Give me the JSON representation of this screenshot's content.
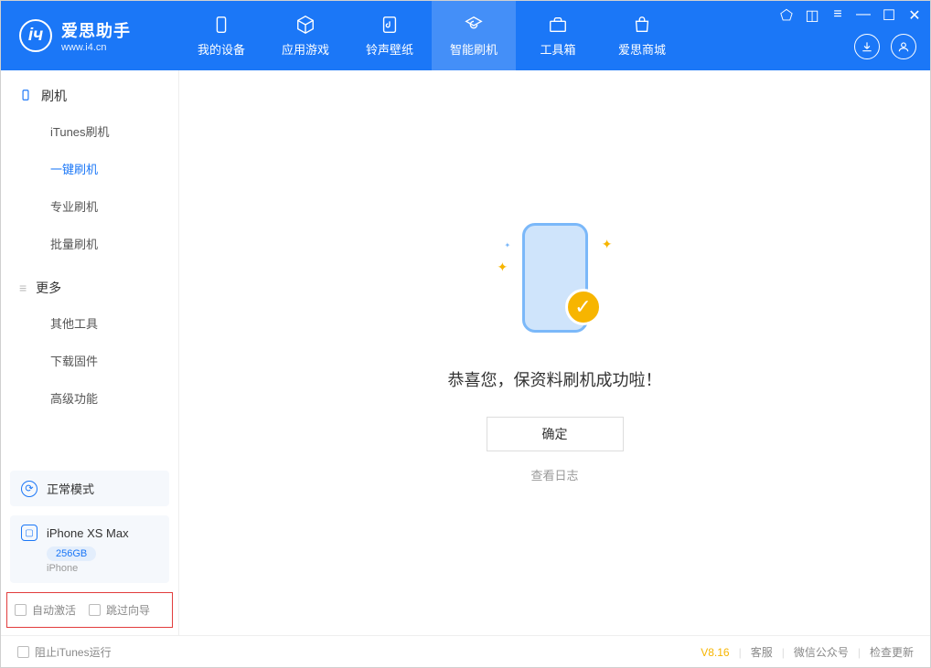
{
  "app": {
    "name": "爱思助手",
    "url": "www.i4.cn"
  },
  "nav": {
    "items": [
      {
        "label": "我的设备"
      },
      {
        "label": "应用游戏"
      },
      {
        "label": "铃声壁纸"
      },
      {
        "label": "智能刷机"
      },
      {
        "label": "工具箱"
      },
      {
        "label": "爱思商城"
      }
    ]
  },
  "sidebar": {
    "section1": {
      "title": "刷机",
      "items": [
        {
          "label": "iTunes刷机"
        },
        {
          "label": "一键刷机"
        },
        {
          "label": "专业刷机"
        },
        {
          "label": "批量刷机"
        }
      ]
    },
    "section2": {
      "title": "更多",
      "items": [
        {
          "label": "其他工具"
        },
        {
          "label": "下载固件"
        },
        {
          "label": "高级功能"
        }
      ]
    },
    "mode": "正常模式",
    "device": {
      "name": "iPhone XS Max",
      "capacity": "256GB",
      "type": "iPhone"
    },
    "opts": {
      "auto_activate": "自动激活",
      "skip_guide": "跳过向导"
    }
  },
  "main": {
    "success_text": "恭喜您，保资料刷机成功啦！",
    "ok_button": "确定",
    "view_log": "查看日志"
  },
  "footer": {
    "block_itunes": "阻止iTunes运行",
    "version": "V8.16",
    "links": {
      "service": "客服",
      "wechat": "微信公众号",
      "update": "检查更新"
    }
  }
}
